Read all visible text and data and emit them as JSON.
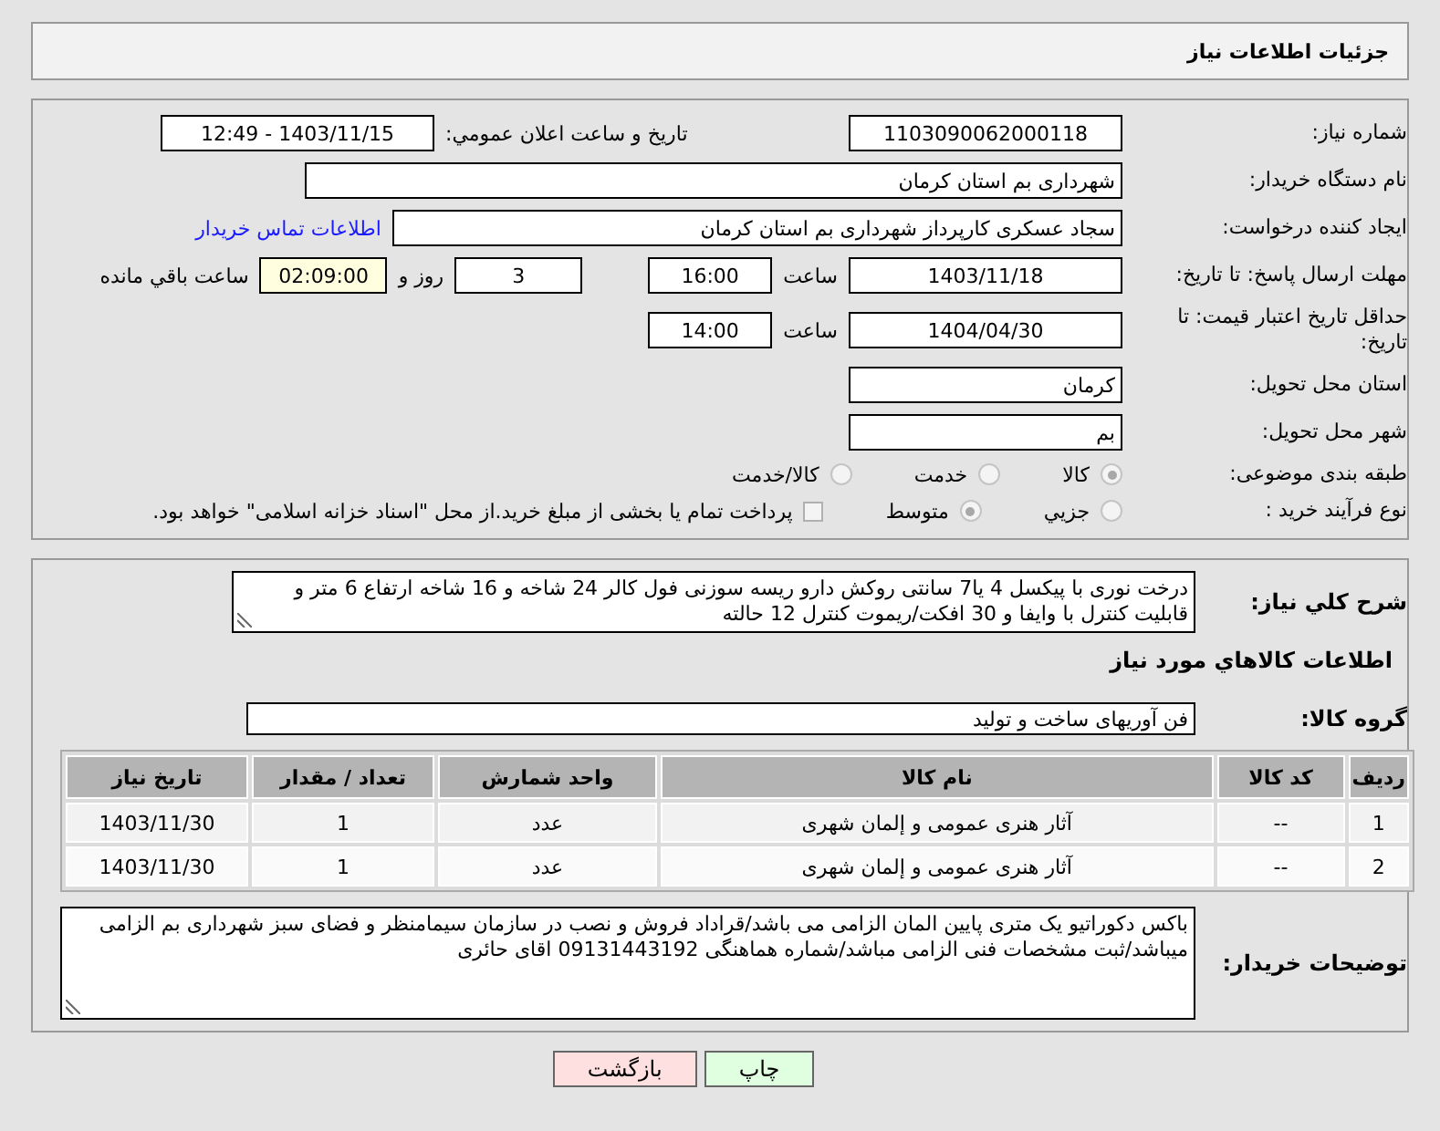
{
  "title": "جزئیات اطلاعات نیاز",
  "info": {
    "need_number": {
      "label": "شماره نیاز:",
      "value": "1103090062000118"
    },
    "announce": {
      "label": "تاریخ و ساعت اعلان عمومي:",
      "value": "1403/11/15 - 12:49"
    },
    "buyer": {
      "label": "نام دستگاه خریدار:",
      "value": "شهرداری بم استان کرمان"
    },
    "creator": {
      "label": "ایجاد کننده درخواست:",
      "value": "سجاد عسکری کارپرداز شهرداری بم استان کرمان",
      "link": "اطلاعات تماس خریدار"
    },
    "deadline": {
      "label": "مهلت ارسال پاسخ: تا تاریخ:",
      "date": "1403/11/18",
      "time_label": "ساعت",
      "time": "16:00",
      "days": "3",
      "days_label": "روز و",
      "remaining": "02:09:00",
      "remaining_label": "ساعت باقي مانده"
    },
    "validity": {
      "label": "حداقل تاریخ اعتبار قیمت: تا تاریخ:",
      "date": "1404/04/30",
      "time_label": "ساعت",
      "time": "14:00"
    },
    "province": {
      "label": "استان محل تحویل:",
      "value": "کرمان"
    },
    "city": {
      "label": "شهر محل تحویل:",
      "value": "بم"
    },
    "category": {
      "label": "طبقه بندی موضوعی:",
      "options": [
        {
          "label": "کالا",
          "selected": true
        },
        {
          "label": "خدمت",
          "selected": false
        },
        {
          "label": "کالا/خدمت",
          "selected": false
        }
      ]
    },
    "process": {
      "label": "نوع فرآیند خرید :",
      "options": [
        {
          "label": "جزیي",
          "selected": false
        },
        {
          "label": "متوسط",
          "selected": true
        }
      ],
      "payment": {
        "checked": false,
        "text": "پرداخت تمام یا بخشی از مبلغ خرید.از محل \"اسناد خزانه اسلامی\" خواهد بود."
      }
    }
  },
  "details": {
    "description": {
      "label": "شرح کلي نیاز:",
      "value": "درخت نوری با پیکسل 4 یا7 سانتی روکش دارو ریسه سوزنی فول کالر  24 شاخه و 16 شاخه ارتفاع 6 متر و قابلیت کنترل با وایفا و 30 افکت/ریموت کنترل 12 حالته"
    },
    "goods_heading": "اطلاعات کالاهاي مورد نیاز",
    "group": {
      "label": "گروه کالا:",
      "value": "فن آوریهای ساخت و تولید"
    },
    "table": {
      "columns": [
        "ردیف",
        "کد کالا",
        "نام کالا",
        "واحد شمارش",
        "تعداد / مقدار",
        "تاریخ نیاز"
      ],
      "rows": [
        [
          "1",
          "--",
          "آثار هنری عمومی و إلمان شهری",
          "عدد",
          "1",
          "1403/11/30"
        ],
        [
          "2",
          "--",
          "آثار هنری عمومی و إلمان شهری",
          "عدد",
          "1",
          "1403/11/30"
        ]
      ]
    },
    "notes": {
      "label": "توضیحات خریدار:",
      "value": "باکس دکوراتیو یک متری پایین المان الزامی می باشد/قراداد فروش و نصب در سازمان سیمامنظر و فضای سبز شهرداری بم الزامی میباشد/ثبت مشخصات فنی الزامی مباشد/شماره هماهنگی 09131443192 اقای حائری"
    }
  },
  "buttons": [
    {
      "kind": "print",
      "label": "چاپ"
    },
    {
      "kind": "back",
      "label": "بازگشت"
    }
  ]
}
